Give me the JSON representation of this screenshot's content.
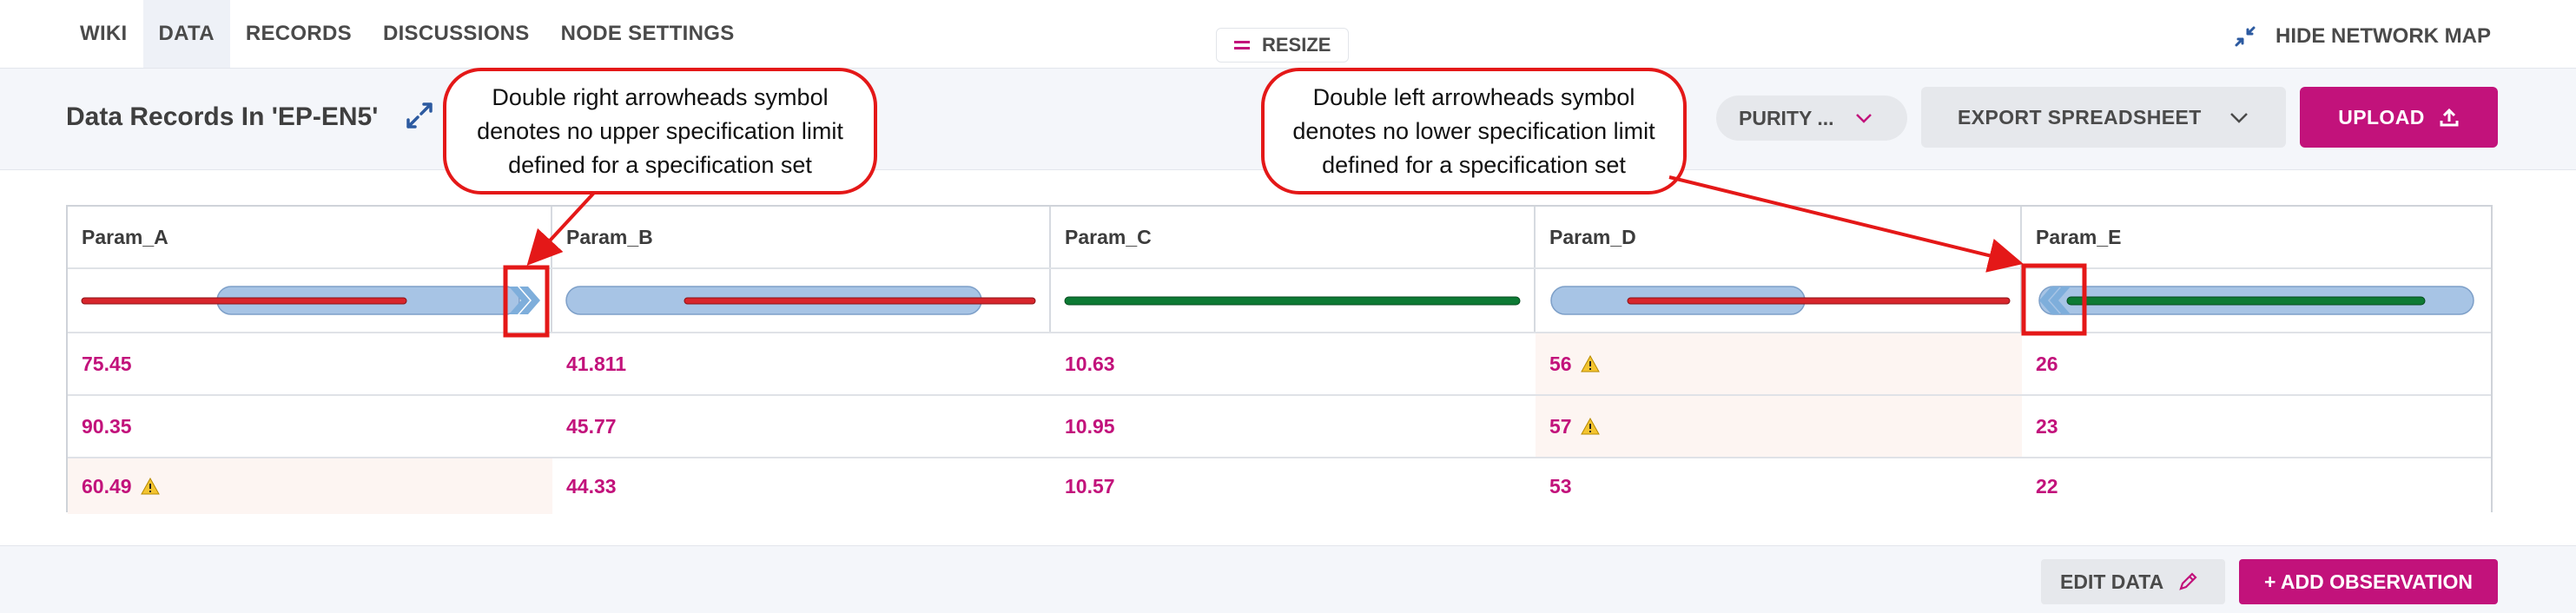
{
  "nav": {
    "tabs": [
      {
        "label": "WIKI"
      },
      {
        "label": "DATA"
      },
      {
        "label": "RECORDS"
      },
      {
        "label": "DISCUSSIONS"
      },
      {
        "label": "NODE SETTINGS"
      }
    ],
    "active_tab": "DATA",
    "resize_label": "RESIZE",
    "hide_map_label": "HIDE NETWORK MAP"
  },
  "header": {
    "title": "Data Records In 'EP-EN5'",
    "purity_label": "PURITY ...",
    "export_label": "EXPORT SPREADSHEET",
    "upload_label": "UPLOAD"
  },
  "table": {
    "columns": [
      "Param_A",
      "Param_B",
      "Param_C",
      "Param_D",
      "Param_E"
    ],
    "rows": [
      [
        {
          "v": "75.45"
        },
        {
          "v": "41.811"
        },
        {
          "v": "10.63"
        },
        {
          "v": "56",
          "warn": true
        },
        {
          "v": "26"
        }
      ],
      [
        {
          "v": "90.35"
        },
        {
          "v": "45.77"
        },
        {
          "v": "10.95"
        },
        {
          "v": "57",
          "warn": true
        },
        {
          "v": "23"
        }
      ],
      [
        {
          "v": "60.49",
          "warn": true
        },
        {
          "v": "44.33"
        },
        {
          "v": "10.57"
        },
        {
          "v": "53"
        },
        {
          "v": "22"
        }
      ]
    ]
  },
  "callouts": {
    "right": "Double right arrowheads symbol denotes no upper specification limit defined for a specification set",
    "left": "Double left arrowheads symbol denotes no lower specification limit defined for a specification set"
  },
  "footer": {
    "edit_label": "EDIT DATA",
    "add_label": "+ ADD OBSERVATION"
  },
  "colors": {
    "accent": "#c2127b",
    "spec_blue": "#a7c4e5",
    "range_red": "#d8262c",
    "range_green": "#0d7a34",
    "callout_red": "#e41818"
  }
}
